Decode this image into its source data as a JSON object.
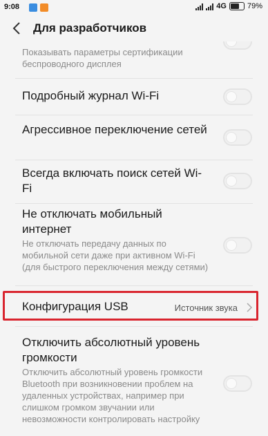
{
  "status_bar": {
    "time": "9:08",
    "network": "4G",
    "battery": "79%",
    "battery_level": 0.79,
    "app_icon_colors": [
      "#3a8de0",
      "#f28c28"
    ]
  },
  "header": {
    "title": "Для разработчиков",
    "back_icon": "chevron-left-icon"
  },
  "settings": {
    "wireless_display": {
      "desc": "Показывать параметры сертификации беспроводного дисплея"
    },
    "wifi_verbose": {
      "label": "Подробный журнал Wi-Fi",
      "enabled": false
    },
    "aggressive_handover": {
      "label": "Агрессивное переключение сетей",
      "enabled": false
    },
    "always_scan": {
      "label": "Всегда включать поиск сетей Wi-Fi",
      "enabled": false
    },
    "mobile_data_active": {
      "label": "Не отключать мобильный интернет",
      "desc": "Не отключать передачу данных по мобильной сети даже при активном Wi-Fi (для быстрого переключения между сетями)",
      "enabled": false
    },
    "usb_config": {
      "label": "Конфигурация USB",
      "value": "Источник звука"
    },
    "absolute_volume": {
      "label": "Отключить абсолютный уровень громкости",
      "desc": "Отключить абсолютный уровень громкости Bluetooth при возникновении проблем на удаленных устройствах, например при слишком громком звучании или невозможности контролировать настройку",
      "enabled": false
    }
  },
  "colors": {
    "highlight": "#d9242e",
    "background": "#f4f4f4"
  }
}
